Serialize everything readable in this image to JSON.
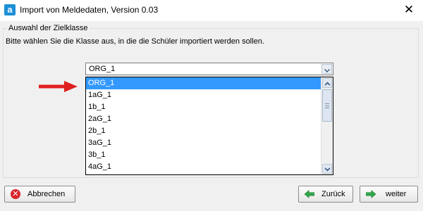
{
  "window": {
    "icon_letter": "a",
    "title": "Import von Meldedaten, Version 0.03",
    "close_glyph": "✕"
  },
  "group": {
    "legend": "Auswahl der Zielklasse",
    "instruction": "Bitte wählen Sie die Klasse aus, in die die Schüler importiert werden sollen."
  },
  "combo": {
    "value": "ORG_1"
  },
  "list": {
    "items": [
      "ORG_1",
      "1aG_1",
      "1b_1",
      "2aG_1",
      "2b_1",
      "3aG_1",
      "3b_1",
      "4aG_1"
    ],
    "selected_index": 0
  },
  "buttons": {
    "cancel": "Abbrechen",
    "back": "Zurück",
    "next": "weiter"
  },
  "colors": {
    "selection": "#3399ff",
    "arrow": "#e02020",
    "cancel_icon": "#d9262c",
    "nav_arrow": "#2ea84a"
  }
}
